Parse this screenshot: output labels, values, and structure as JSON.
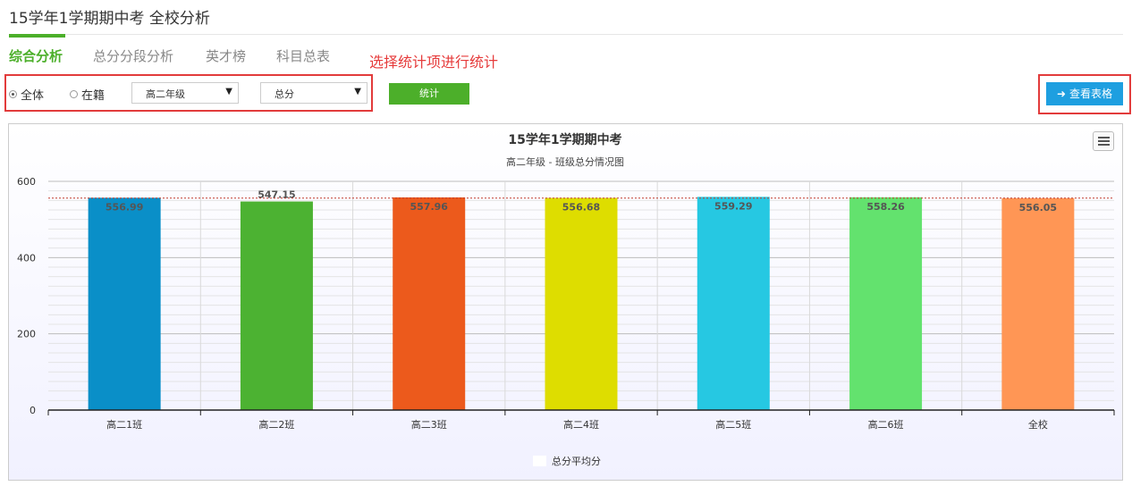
{
  "page": {
    "title": "15学年1学期期中考  全校分析"
  },
  "tabs": [
    {
      "label": "综合分析",
      "active": true
    },
    {
      "label": "总分分段分析",
      "active": false
    },
    {
      "label": "英才榜",
      "active": false
    },
    {
      "label": "科目总表",
      "active": false
    }
  ],
  "hint": "选择统计项进行统计",
  "filters": {
    "radio_all": "全体",
    "radio_enrolled": "在籍",
    "selected_radio": "全体",
    "grade_select": "高二年级",
    "subject_select": "总分",
    "stat_button": "统计"
  },
  "view_table_button": "查看表格",
  "colors": {
    "accent": "#4caf2a",
    "hint_red": "#e63b3b",
    "button_blue": "#1e9fe0"
  },
  "chart_data": {
    "type": "bar",
    "title": "15学年1学期期中考",
    "subtitle": "高二年级 - 班级总分情况图",
    "categories": [
      "高二1班",
      "高二2班",
      "高二3班",
      "高二4班",
      "高二5班",
      "高二6班",
      "全校"
    ],
    "series": [
      {
        "name": "总分平均分",
        "values": [
          556.99,
          547.15,
          557.96,
          556.68,
          559.29,
          558.26,
          556.05
        ]
      }
    ],
    "bar_colors": [
      "#0a8fc8",
      "#4cb232",
      "#ec5a1c",
      "#dedd00",
      "#26c8e2",
      "#63e26e",
      "#ff9655"
    ],
    "reference_line": 556.05,
    "ylim": [
      0,
      600
    ],
    "yticks": [
      0,
      200,
      400,
      600
    ],
    "grid": true,
    "legend": "bottom-center"
  }
}
